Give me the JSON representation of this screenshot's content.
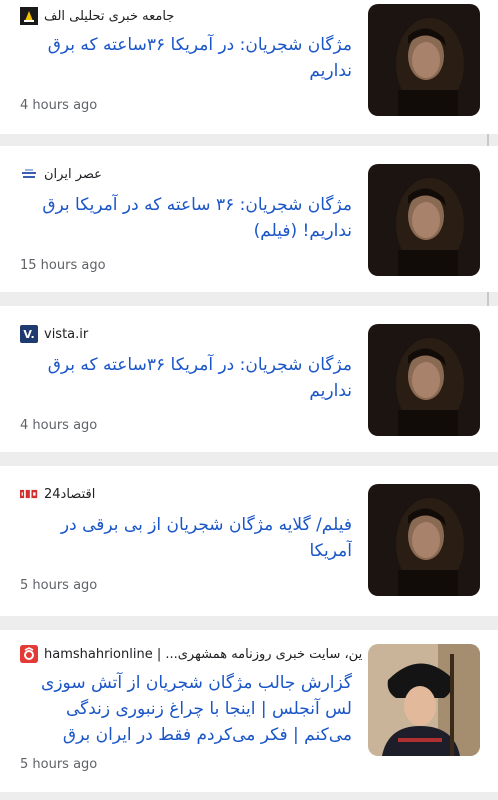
{
  "feed": {
    "items": [
      {
        "source": "جامعه خبری تحلیلی الف",
        "source_logo": "alef-logo-icon",
        "logo_color": "#1a1a1a",
        "logo_text": "",
        "headline": "مژگان شجریان: در آمریکا ۳۶ساعته که برق نداریم",
        "time": "4 hours ago",
        "thumbnail": "woman-portrait-dark"
      },
      {
        "source": "عصر ایران",
        "source_logo": "asriran-logo-icon",
        "logo_color": "#ffffff",
        "logo_text": "",
        "headline": "مژگان شجریان: ۳۶ ساعته که در آمریکا برق نداریم! (فیلم)",
        "time": "15 hours ago",
        "thumbnail": "woman-portrait-dark"
      },
      {
        "source": "vista.ir",
        "source_logo": "vista-logo-icon",
        "logo_color": "#1f3a6e",
        "logo_text": "V.",
        "headline": "مژگان شجریان: در آمریکا ۳۶ساعته که برق نداریم",
        "time": "4 hours ago",
        "thumbnail": "woman-portrait-dark"
      },
      {
        "source": "اقتصاد24",
        "source_logo": "eghtesad24-logo-icon",
        "logo_color": "#d32f2f",
        "logo_text": "",
        "headline": "فیلم/ گلایه مژگان شجریان از بی برقی در آمریکا",
        "time": "5 hours ago",
        "thumbnail": "woman-portrait-dark"
      },
      {
        "source": "hamshahrionline | ...ین، سایت خبری روزنامه همشهری",
        "source_logo": "hamshahri-logo-icon",
        "logo_color": "#e53935",
        "logo_text": "",
        "headline": "گزارش جالب مژگان شجریان از آتش سوزی لس آنجلس | اینجا با چراغ زنبوری زندگی می‌کنم | فکر می‌کردم فقط در ایران برق نیست اما...",
        "time": "5 hours ago",
        "thumbnail": "woman-portrait-headwrap"
      }
    ]
  }
}
